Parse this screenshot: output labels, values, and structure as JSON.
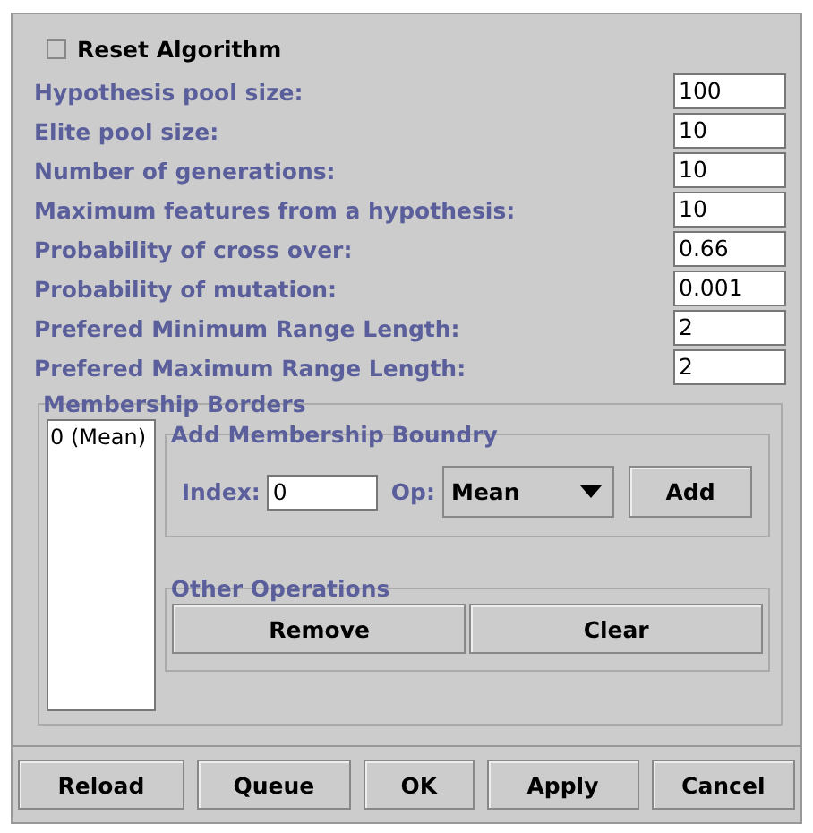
{
  "reset_checkbox": {
    "label": "Reset Algorithm",
    "checked": false
  },
  "parameters": [
    {
      "label": "Hypothesis pool size:",
      "value": "100"
    },
    {
      "label": "Elite pool size:",
      "value": "10"
    },
    {
      "label": "Number of generations:",
      "value": "10"
    },
    {
      "label": "Maximum features from a hypothesis:",
      "value": "10"
    },
    {
      "label": "Probability of cross over:",
      "value": "0.66"
    },
    {
      "label": "Probability of mutation:",
      "value": "0.001"
    },
    {
      "label": "Prefered Minimum Range Length:",
      "value": "2"
    },
    {
      "label": "Prefered Maximum Range Length:",
      "value": "2"
    }
  ],
  "membership_borders": {
    "title": "Membership Borders",
    "list_items": [
      {
        "label": "0 (Mean)",
        "selected": false
      }
    ],
    "add_boundary": {
      "title": "Add Membership Boundry",
      "index_label": "Index:",
      "index_value": "0",
      "op_label": "Op:",
      "op_value": "Mean",
      "add_button": "Add"
    },
    "other_operations": {
      "title": "Other Operations",
      "buttons": [
        "Remove",
        "Clear"
      ]
    }
  },
  "buttons": [
    "Reload",
    "Queue",
    "OK",
    "Apply",
    "Cancel"
  ]
}
